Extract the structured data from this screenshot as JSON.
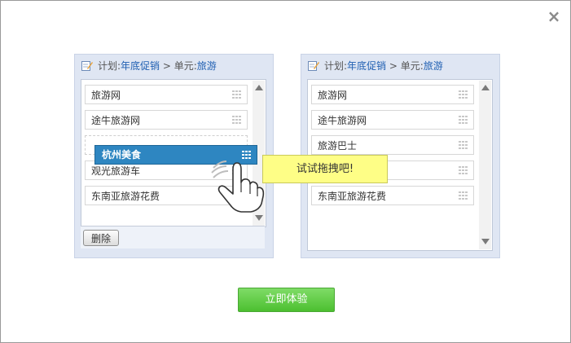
{
  "dialog": {
    "close_label": "×"
  },
  "left_panel": {
    "header": {
      "plan_label": "计划:",
      "plan_name": "年底促销",
      "sep": " > ",
      "unit_label": "单元:",
      "unit_name": "旅游"
    },
    "items": [
      {
        "label": "旅游网"
      },
      {
        "label": "途牛旅游网"
      },
      {
        "label": "观光旅游车"
      },
      {
        "label": "东南亚旅游花费"
      }
    ],
    "delete_label": "删除"
  },
  "right_panel": {
    "header": {
      "plan_label": "计划:",
      "plan_name": "年底促销",
      "sep": " > ",
      "unit_label": "单元:",
      "unit_name": "旅游"
    },
    "items": [
      {
        "label": "旅游网"
      },
      {
        "label": "途牛旅游网"
      },
      {
        "label": "旅游巴士"
      },
      {
        "label": ""
      },
      {
        "label": "东南亚旅游花费"
      }
    ]
  },
  "dragging_item": {
    "label": "杭州美食"
  },
  "tooltip": {
    "text": "试试拖拽吧!"
  },
  "try_button": {
    "label": "立即体验"
  },
  "colors": {
    "accent_blue": "#2e86c1",
    "header_link": "#1f5fb2",
    "tooltip_bg": "#fefe86",
    "button_green": "#4cbf30",
    "panel_bg": "#dfe6f3"
  },
  "icons": {
    "header": "edit-note-icon",
    "close": "close-icon",
    "grip": "drag-grip-icon",
    "hand": "hand-cursor-icon"
  }
}
